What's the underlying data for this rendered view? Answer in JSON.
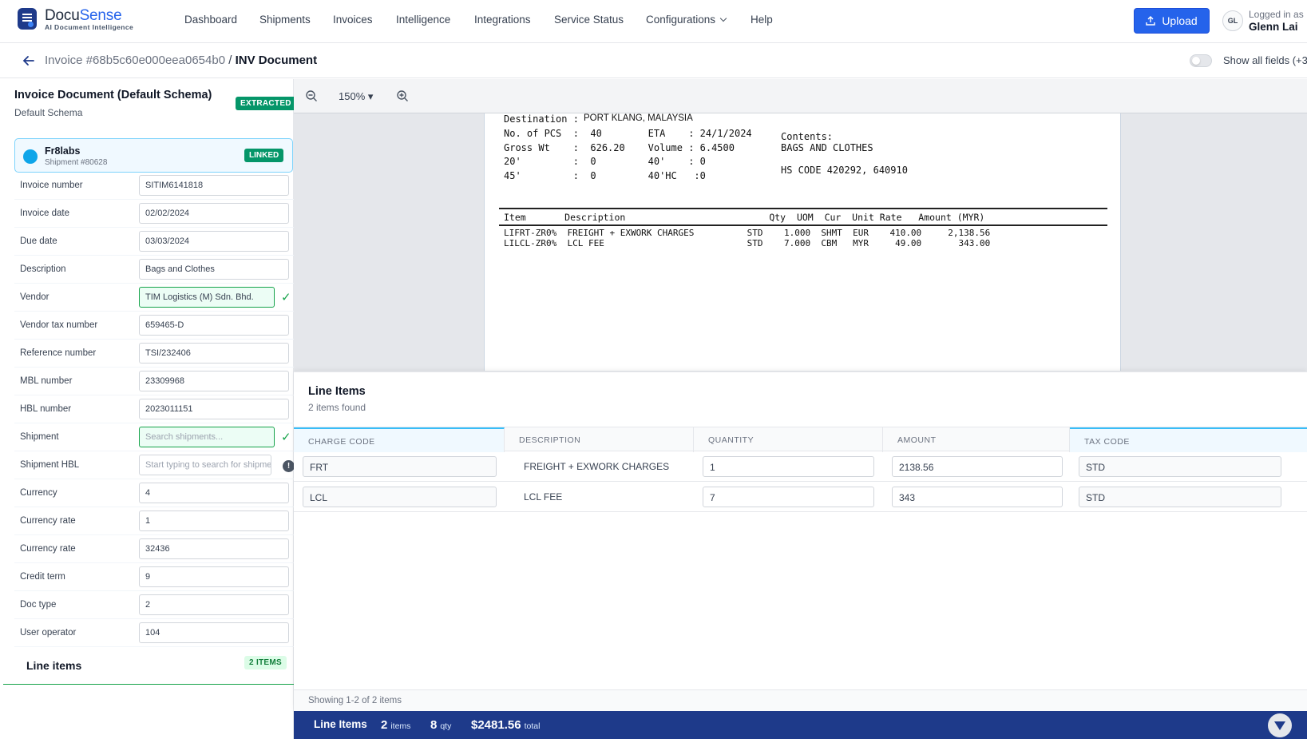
{
  "app": {
    "brand_part1": "Docu",
    "brand_part2": "Sense",
    "tagline": "AI Document Intelligence"
  },
  "nav": {
    "items": [
      "Dashboard",
      "Shipments",
      "Invoices",
      "Intelligence",
      "Integrations",
      "Service Status",
      "Configurations",
      "Help"
    ],
    "upload_label": "Upload",
    "user_initials": "GL",
    "logged_in_label": "Logged in as",
    "user_name": "Glenn Lai"
  },
  "header": {
    "breadcrumb_invoice": "Invoice #68b5c60e000eea0654b0",
    "breadcrumb_sep": " / ",
    "breadcrumb_current": "INV Document",
    "show_all_fields_label": "Show all fields (+3"
  },
  "left": {
    "doc_title": "Invoice Document (Default Schema)",
    "doc_schema": "Default Schema",
    "status_badge": "EXTRACTED",
    "link": {
      "name": "Fr8labs",
      "sub": "Shipment #80628",
      "badge": "LINKED"
    },
    "fields": [
      {
        "label": "Invoice number",
        "value": "SITIM6141818"
      },
      {
        "label": "Invoice date",
        "value": "02/02/2024"
      },
      {
        "label": "Due date",
        "value": "03/03/2024"
      },
      {
        "label": "Description",
        "value": "Bags and Clothes"
      },
      {
        "label": "Vendor",
        "value": "TIM Logistics (M) Sdn. Bhd."
      },
      {
        "label": "Vendor tax number",
        "value": "659465-D"
      },
      {
        "label": "Reference number",
        "value": "TSI/232406"
      },
      {
        "label": "MBL number",
        "value": "23309968"
      },
      {
        "label": "HBL number",
        "value": "2023011151"
      },
      {
        "label": "Shipment",
        "placeholder": "Search shipments..."
      },
      {
        "label": "Shipment HBL",
        "placeholder": "Start typing to search for shipme"
      },
      {
        "label": "Currency",
        "value": "4"
      },
      {
        "label": "Currency rate",
        "value": "1"
      },
      {
        "label": "Currency rate",
        "value": "32436"
      },
      {
        "label": "Credit term",
        "value": "9"
      },
      {
        "label": "Doc type",
        "value": "2"
      },
      {
        "label": "User operator",
        "value": "104"
      }
    ],
    "check_glyph": "✓",
    "warn_glyph": "!",
    "line_items_label": "Line items",
    "line_items_badge": "2 ITEMS"
  },
  "viewer": {
    "zoom": "150%",
    "zoom_caret": "▾",
    "doc_lines": {
      "l1": "Destination :",
      "l1v": "PORT KLANG, MALAYSIA",
      "l2": "No. of PCS  :  40        ETA    : 24/1/2024",
      "l3": "Gross Wt    :  626.20    Volume : 6.4500",
      "l4": "20'         :  0         40'    : 0",
      "l5": "45'         :  0         40'HC   :0",
      "c1": "Contents:",
      "c2": "BAGS AND CLOTHES",
      "c3": "HS CODE 420292, 640910",
      "header": "Item       Description                          Qty  UOM  Cur  Unit Rate   Amount (MYR)",
      "r1": "LIFRT-ZR0%  FREIGHT + EXWORK CHARGES          STD    1.000  SHMT  EUR    410.00     2,138.56",
      "r2": "LILCL-ZR0%  LCL FEE                           STD    7.000  CBM   MYR     49.00       343.00"
    }
  },
  "line_items": {
    "title": "Line Items",
    "subtitle": "2 items found",
    "columns": [
      "CHARGE CODE",
      "DESCRIPTION",
      "QUANTITY",
      "AMOUNT",
      "TAX CODE"
    ],
    "rows": [
      {
        "charge_code": "FRT",
        "description": "FREIGHT + EXWORK CHARGES",
        "quantity": "1",
        "amount": "2138.56",
        "tax_code": "STD"
      },
      {
        "charge_code": "LCL",
        "description": "LCL FEE",
        "quantity": "7",
        "amount": "343",
        "tax_code": "STD"
      }
    ],
    "footer": "Showing 1-2 of 2 items"
  },
  "summary": {
    "label": "Line Items",
    "items_value": "2",
    "items_unit": "items",
    "qty_value": "8",
    "qty_unit": "qty",
    "total_value": "$2481.56",
    "total_unit": "total"
  },
  "colors": {
    "primary": "#2563eb",
    "success": "#059669",
    "summary_bar": "#1e3a8a"
  }
}
